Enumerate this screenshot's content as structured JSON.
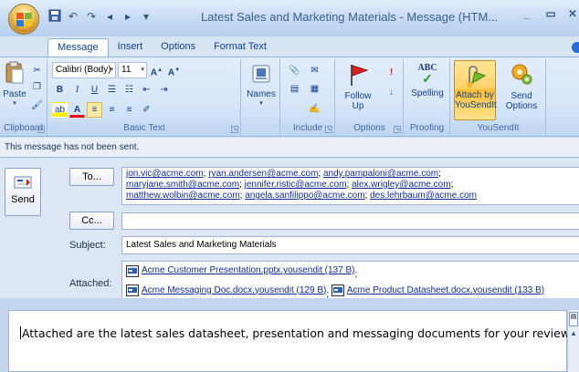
{
  "window": {
    "title": "Latest Sales and Marketing Materials - Message (HTM..."
  },
  "ribbon": {
    "tabs": [
      "Message",
      "Insert",
      "Options",
      "Format Text"
    ],
    "active_tab": "Message",
    "clipboard": {
      "paste_label": "Paste",
      "group_label": "Clipboard"
    },
    "basic_text": {
      "font": "Calibri (Body)",
      "size": "11",
      "bold": "B",
      "italic": "I",
      "underline": "U",
      "group_label": "Basic Text"
    },
    "names": {
      "label": "Names"
    },
    "include": {
      "group_label": "Include"
    },
    "options": {
      "follow_up_label": "Follow Up",
      "group_label": "Options"
    },
    "proofing": {
      "spelling_label": "Spelling",
      "group_label": "Proofing",
      "abc": "ABC"
    },
    "yousendit": {
      "attach_label_1": "Attach by",
      "attach_label_2": "YouSendIt",
      "send_label_1": "Send",
      "send_label_2": "Options",
      "group_label": "YouSendIt"
    }
  },
  "infobar": {
    "text": "This message has not been sent."
  },
  "compose": {
    "send_label": "Send",
    "to_label": "To...",
    "cc_label": "Cc...",
    "subject_label": "Subject:",
    "attached_label": "Attached:",
    "subject_value": "Latest Sales and Marketing Materials",
    "to_recipients": [
      "jon.vic@acme.com",
      "ryan.andersen@acme.com",
      "andy.pampaloni@acme.com",
      "maryjane.smith@acme.com",
      "jennifer.ristic@acme.com",
      "alex.wrigley@acme.com",
      "matthew.wolbin@acme.com",
      "angela.sanfilippo@acme.com",
      "des.lehrbaum@acme.com"
    ],
    "attachments": [
      "Acme Customer Presentation.pptx.yousendit (137 B)",
      "Acme Messaging Doc.docx.yousendit (129 B)",
      "Acme Product Datasheet.docx.yousendit (133 B)"
    ]
  },
  "body": {
    "text": "Attached are the latest sales datasheet, presentation and messaging documents for your review."
  }
}
